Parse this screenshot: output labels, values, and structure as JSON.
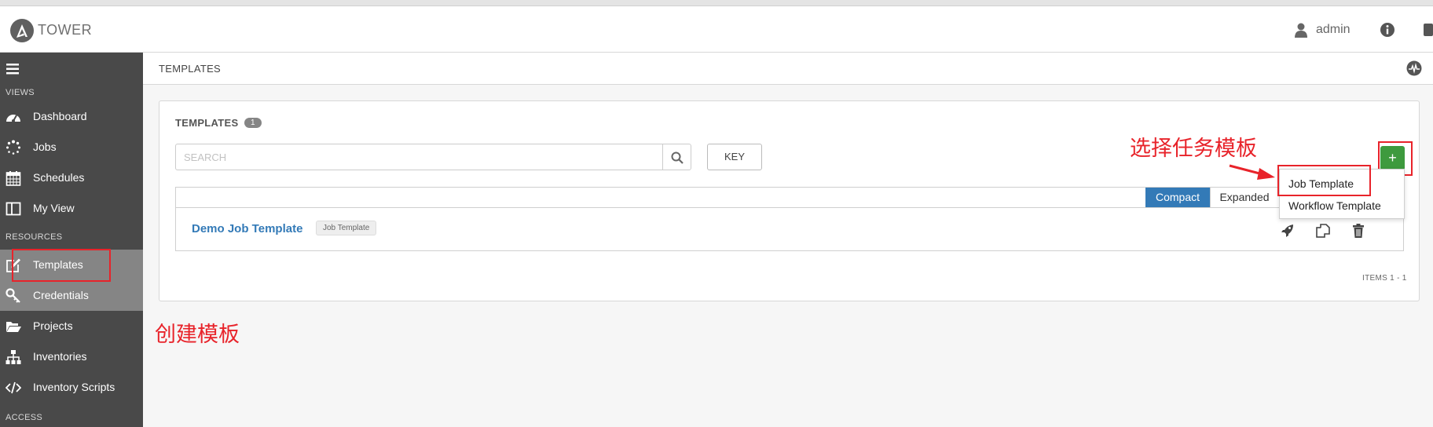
{
  "header": {
    "logo_letter": "A",
    "logo_text": "TOWER",
    "user_label": "admin"
  },
  "sidebar": {
    "views_heading": "VIEWS",
    "resources_heading": "RESOURCES",
    "access_heading": "ACCESS",
    "items": [
      {
        "label": "Dashboard",
        "icon": "dashboard-icon"
      },
      {
        "label": "Jobs",
        "icon": "spinner-icon"
      },
      {
        "label": "Schedules",
        "icon": "calendar-icon"
      },
      {
        "label": "My View",
        "icon": "columns-icon"
      },
      {
        "label": "Templates",
        "icon": "edit-icon",
        "active": true
      },
      {
        "label": "Credentials",
        "icon": "key-icon"
      },
      {
        "label": "Projects",
        "icon": "folder-open-icon"
      },
      {
        "label": "Inventories",
        "icon": "sitemap-icon"
      },
      {
        "label": "Inventory Scripts",
        "icon": "code-icon"
      }
    ]
  },
  "subheader": {
    "title": "TEMPLATES"
  },
  "panel": {
    "title": "TEMPLATES",
    "count": "1",
    "search_placeholder": "SEARCH",
    "key_label": "KEY",
    "view_toggle": {
      "compact": "Compact",
      "expanded": "Expanded"
    },
    "rows": [
      {
        "name": "Demo Job Template",
        "type": "Job Template"
      }
    ],
    "items_label": "ITEMS  1 - 1"
  },
  "add_button": {
    "label": "+"
  },
  "add_menu": {
    "items": [
      "Job Template",
      "Workflow Template"
    ]
  },
  "annotations": {
    "select_template": "选择任务模板",
    "create_template": "创建模板",
    "color": "#e8232a"
  },
  "colors": {
    "sidebar_bg": "#494949",
    "sidebar_active": "#858585",
    "link_blue": "#337ab7",
    "add_green": "#3e9a3e"
  }
}
